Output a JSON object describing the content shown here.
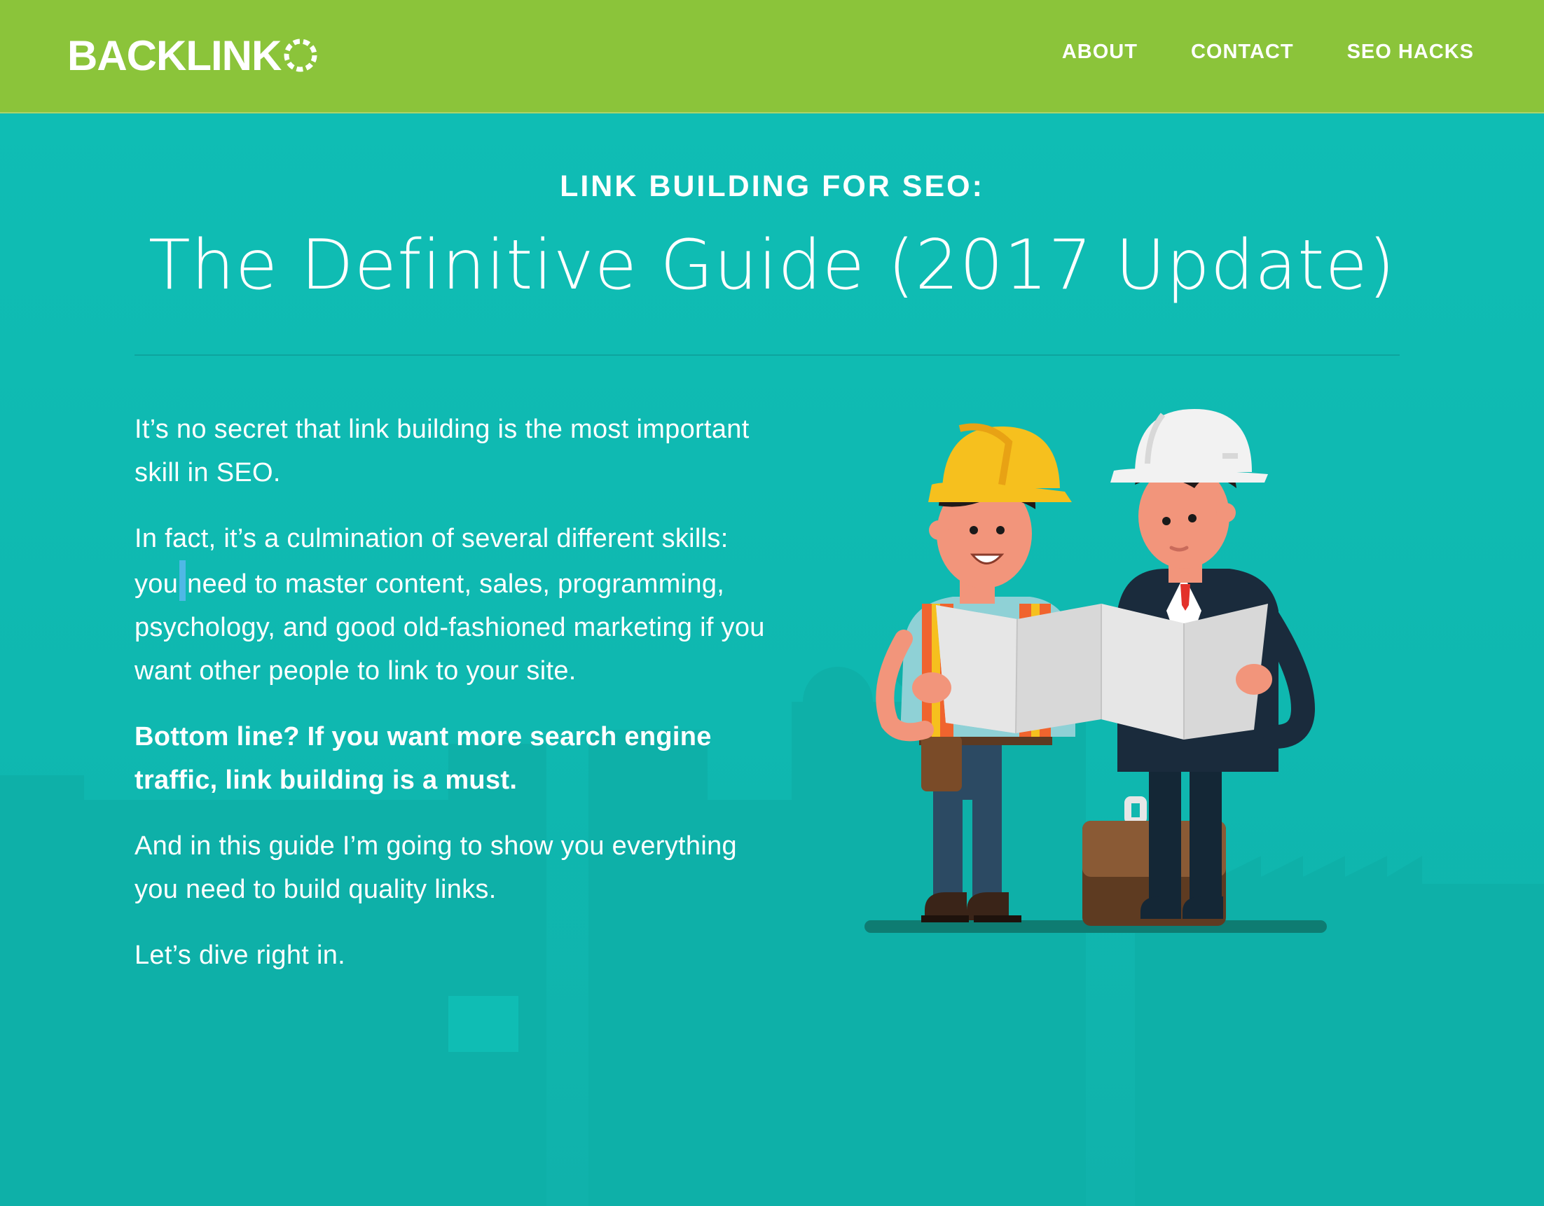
{
  "header": {
    "logo_text": "BACKLINK",
    "nav": [
      {
        "label": "ABOUT"
      },
      {
        "label": "CONTACT"
      },
      {
        "label": "SEO HACKS"
      }
    ]
  },
  "hero": {
    "eyebrow": "LINK BUILDING FOR SEO:",
    "title": "The Definitive Guide (2017 Update)",
    "paragraphs": {
      "p1": "It’s no secret that link building is the most important skill in SEO.",
      "p2_before": "In fact, it’s a culmination of several different skills: you",
      "p2_after": "need to master content, sales, programming, psychology, and good old-fashioned marketing if you want other people to link to your site.",
      "p3": "Bottom line? If you want more search engine traffic, link building is a must.",
      "p4": "And in this guide I’m going to show you everything you need to build quality links.",
      "p5": "Let’s dive right in."
    },
    "illustration": "two-workers-reading-blueprint"
  },
  "colors": {
    "header_bg": "#8bc43a",
    "hero_bg": "#0fbdb4",
    "text": "#ffffff"
  }
}
